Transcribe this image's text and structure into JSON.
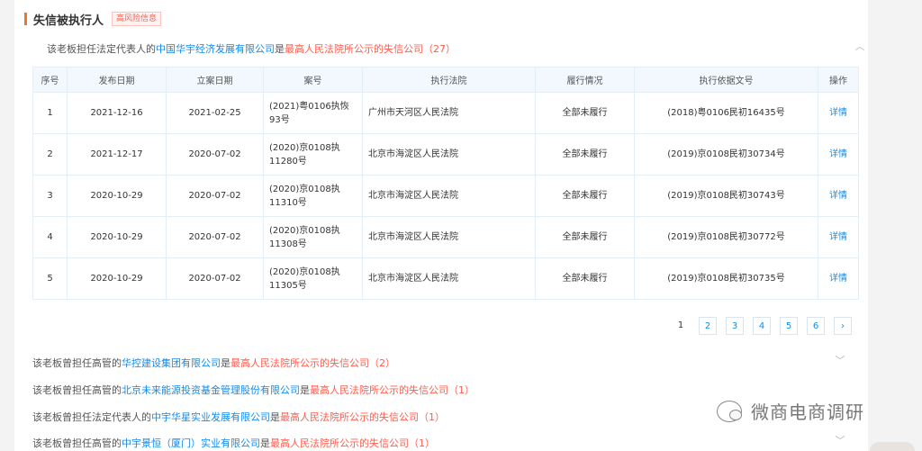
{
  "section": {
    "title": "失信被执行人",
    "risk_badge": "高风险信息"
  },
  "top_record": {
    "prefix": "该老板担任法定代表人的",
    "company": "中国华宇经济发展有限公司",
    "middle": "是",
    "court_text": "最高人民法院所公示的失信公司",
    "count": "（27）",
    "toggle_icon": "chevron-up"
  },
  "table": {
    "headers": [
      "序号",
      "发布日期",
      "立案日期",
      "案号",
      "执行法院",
      "履行情况",
      "执行依据文号",
      "操作"
    ],
    "rows": [
      {
        "no": "1",
        "pub_date": "2021-12-16",
        "filing_date": "2021-02-25",
        "case_no": "(2021)粤0106执恢93号",
        "court": "广州市天河区人民法院",
        "status": "全部未履行",
        "basis": "(2018)粤0106民初16435号",
        "action": "详情"
      },
      {
        "no": "2",
        "pub_date": "2021-12-17",
        "filing_date": "2020-07-02",
        "case_no": "(2020)京0108执11280号",
        "court": "北京市海淀区人民法院",
        "status": "全部未履行",
        "basis": "(2019)京0108民初30734号",
        "action": "详情"
      },
      {
        "no": "3",
        "pub_date": "2020-10-29",
        "filing_date": "2020-07-02",
        "case_no": "(2020)京0108执11310号",
        "court": "北京市海淀区人民法院",
        "status": "全部未履行",
        "basis": "(2019)京0108民初30743号",
        "action": "详情"
      },
      {
        "no": "4",
        "pub_date": "2020-10-29",
        "filing_date": "2020-07-02",
        "case_no": "(2020)京0108执11308号",
        "court": "北京市海淀区人民法院",
        "status": "全部未履行",
        "basis": "(2019)京0108民初30772号",
        "action": "详情"
      },
      {
        "no": "5",
        "pub_date": "2020-10-29",
        "filing_date": "2020-07-02",
        "case_no": "(2020)京0108执11305号",
        "court": "北京市海淀区人民法院",
        "status": "全部未履行",
        "basis": "(2019)京0108民初30735号",
        "action": "详情"
      }
    ]
  },
  "pagination": {
    "pages": [
      "1",
      "2",
      "3",
      "4",
      "5",
      "6"
    ],
    "current": "1",
    "next": "›"
  },
  "other_records": [
    {
      "prefix": "该老板曾担任高管的",
      "company": "华控建设集团有限公司",
      "middle": "是",
      "court_text": "最高人民法院所公示的失信公司",
      "count": "（2）"
    },
    {
      "prefix": "该老板曾担任高管的",
      "company": "北京未来能源投资基金管理股份有限公司",
      "middle": "是",
      "court_text": "最高人民法院所公示的失信公司",
      "count": "（1）"
    },
    {
      "prefix": "该老板曾担任法定代表人的",
      "company": "中宇华星实业发展有限公司",
      "middle": "是",
      "court_text": "最高人民法院所公示的失信公司",
      "count": "（1）"
    },
    {
      "prefix": "该老板曾担任高管的",
      "company": "中宇景恒（厦门）实业有限公司",
      "middle": "是",
      "court_text": "最高人民法院所公示的失信公司",
      "count": "（1）"
    }
  ],
  "watermark": {
    "text": "微商电商调研",
    "icon": "wechat-icon"
  },
  "colors": {
    "accent_blue": "#128bed",
    "risk_red": "#ff5c4c",
    "section_bar": "#e8792b"
  }
}
